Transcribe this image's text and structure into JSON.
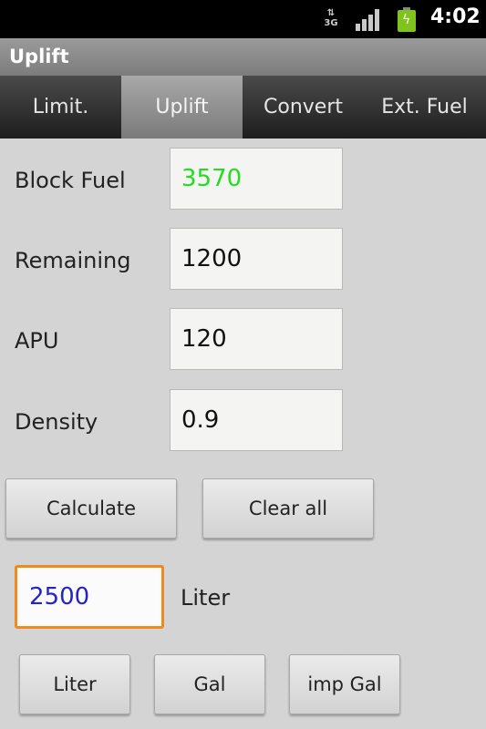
{
  "status_bar": {
    "network": "3G",
    "time": "4:02",
    "icons": [
      "data-3g-icon",
      "signal-icon",
      "battery-charging-icon"
    ]
  },
  "title_bar": {
    "title": "Uplift"
  },
  "tabs": [
    {
      "label": "Limit.",
      "active": false
    },
    {
      "label": "Uplift",
      "active": true
    },
    {
      "label": "Convert",
      "active": false
    },
    {
      "label": "Ext. Fuel",
      "active": false
    }
  ],
  "form": {
    "block_fuel": {
      "label": "Block Fuel",
      "value": "3570",
      "color": "#22dd22"
    },
    "remaining": {
      "label": "Remaining",
      "value": "1200"
    },
    "apu": {
      "label": "APU",
      "value": "120"
    },
    "density": {
      "label": "Density",
      "value": "0.9"
    }
  },
  "actions": {
    "calculate": "Calculate",
    "clear_all": "Clear all"
  },
  "result": {
    "value": "2500",
    "unit": "Liter"
  },
  "unit_buttons": {
    "liter": "Liter",
    "gal": "Gal",
    "imp_gal": "imp Gal"
  }
}
